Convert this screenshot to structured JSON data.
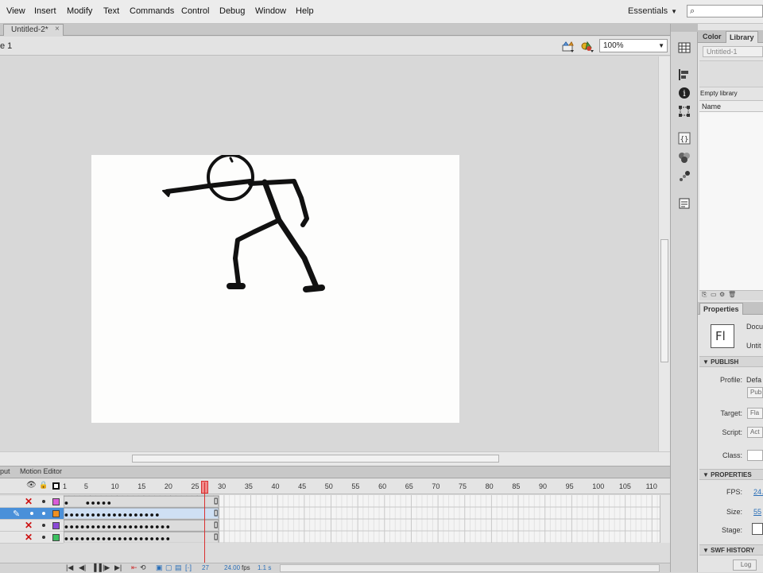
{
  "menu": [
    "View",
    "Insert",
    "Modify",
    "Text",
    "Commands",
    "Control",
    "Debug",
    "Window",
    "Help"
  ],
  "workspace": {
    "label": "Essentials"
  },
  "search": {
    "icon": "search-icon"
  },
  "doc_tab": {
    "title": "Untitled-2*",
    "close": "×"
  },
  "edit_bar": {
    "scene": "e 1",
    "zoom": "100%"
  },
  "timeline": {
    "tabs": [
      "put",
      "Motion Editor"
    ],
    "frame_numbers": [
      "1",
      "5",
      "10",
      "15",
      "20",
      "25",
      "30",
      "35",
      "40",
      "45",
      "50",
      "55",
      "60",
      "65",
      "70",
      "75",
      "80",
      "85",
      "90",
      "95",
      "100",
      "105",
      "110"
    ],
    "current_frame": "27",
    "fps": "24.00",
    "fps_unit": "fps",
    "elapsed": "1.1 s",
    "layers": [
      {
        "color": "#d95cd9",
        "selected": false
      },
      {
        "color": "#f09020",
        "selected": true
      },
      {
        "color": "#8a4ad6",
        "selected": false
      },
      {
        "color": "#3cc060",
        "selected": false
      }
    ]
  },
  "panels": {
    "tabs": {
      "color": "Color",
      "library": "Library"
    },
    "library": {
      "doc": "Untitled-1",
      "empty": "Empty library",
      "name_col": "Name"
    },
    "properties": {
      "tab": "Properties",
      "logo": "Fl",
      "doc_type": "Docu",
      "doc_name": "Untit",
      "publish_header": "PUBLISH",
      "profile_label": "Profile:",
      "profile_value": "Defa",
      "publish_button": "Pub",
      "target_label": "Target:",
      "target_value": "Fla",
      "script_label": "Script:",
      "script_value": "Act",
      "class_label": "Class:",
      "properties_header": "PROPERTIES",
      "fps_label": "FPS:",
      "fps_value": "24.",
      "size_label": "Size:",
      "size_value": "55",
      "stage_label": "Stage:",
      "swf_header": "SWF HISTORY",
      "log_button": "Log"
    }
  }
}
